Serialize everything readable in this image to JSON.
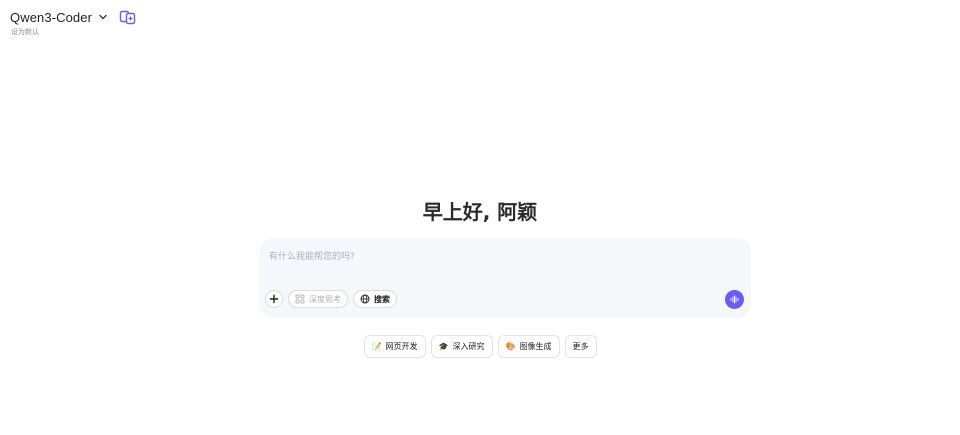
{
  "header": {
    "model_name": "Qwen3-Coder",
    "set_default_label": "设为默认"
  },
  "greeting": "早上好, 阿颖",
  "chat": {
    "placeholder": "有什么我能帮您的吗?",
    "toolbar": {
      "deep_think_label": "深度思考",
      "search_label": "搜索"
    }
  },
  "suggestions": [
    {
      "label": "网页开发",
      "icon": "📝"
    },
    {
      "label": "深入研究",
      "icon": "🎓"
    },
    {
      "label": "图像生成",
      "icon": "🎨"
    },
    {
      "label": "更多",
      "icon": ""
    }
  ],
  "colors": {
    "accent": "#6a5cf6",
    "input_bg": "#f6f7fb",
    "compare_icon": "#6a5cf6"
  }
}
